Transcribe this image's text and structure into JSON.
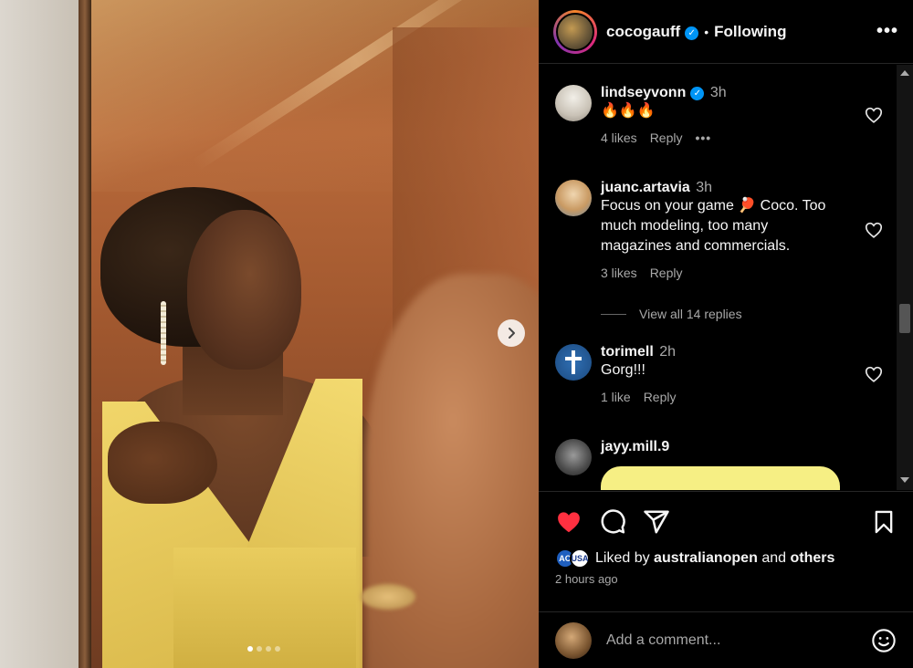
{
  "post": {
    "author": "cocogauff",
    "follow_state": "Following",
    "separator": "•",
    "more_glyph": "•••",
    "carousel": {
      "slides": 4,
      "active_index": 0
    }
  },
  "comments": [
    {
      "username": "lindseyvonn",
      "verified": true,
      "time": "3h",
      "text": "🔥🔥🔥",
      "likes": "4 likes",
      "reply": "Reply",
      "more": "•••"
    },
    {
      "username": "juanc.artavia",
      "verified": false,
      "time": "3h",
      "text": "Focus on your game 🏓 Coco. Too much modeling, too many magazines and commercials.",
      "likes": "3 likes",
      "reply": "Reply"
    },
    {
      "username": "torimell",
      "verified": false,
      "time": "2h",
      "text": "Gorg!!!",
      "likes": "1 like",
      "reply": "Reply"
    },
    {
      "username": "jayy.mill.9",
      "verified": false,
      "time": "",
      "text": ""
    }
  ],
  "view_replies": "View all 14 replies",
  "likes": {
    "prefix": "Liked by",
    "user": "australianopen",
    "joiner": "and",
    "suffix": "others",
    "avatar_a": "AO",
    "avatar_b": "USA"
  },
  "post_time": "2 hours ago",
  "add_comment": {
    "placeholder": "Add a comment..."
  },
  "colors": {
    "like_red": "#ff3040",
    "verified_blue": "#0095f6",
    "background": "#000000"
  },
  "icons": [
    "heart-filled-icon",
    "comment-icon",
    "share-icon",
    "bookmark-icon",
    "chevron-right-icon",
    "emoji-icon",
    "verified-icon"
  ]
}
